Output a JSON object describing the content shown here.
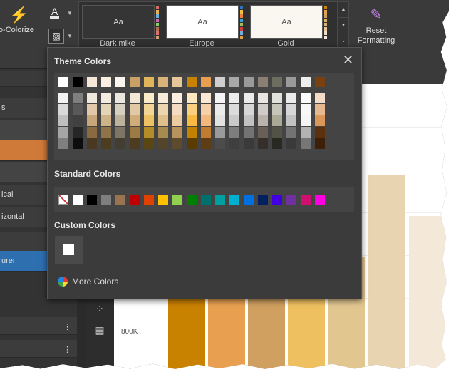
{
  "ribbon": {
    "auto_colorize_label": "o-Colorize",
    "font_color_glyph": "A",
    "fill_glyph": "▨",
    "reset_formatting_label": "Reset\nFormatting",
    "themes": [
      {
        "name": "Dark mike",
        "sample": "Aa",
        "bg": "#353535",
        "fg": "#d8d8d8"
      },
      {
        "name": "Europe",
        "sample": "Aa",
        "bg": "#ffffff",
        "fg": "#555555"
      },
      {
        "name": "Gold",
        "sample": "Aa",
        "bg": "#faf6f0",
        "fg": "#555555"
      }
    ]
  },
  "left_pane": {
    "items": [
      "s",
      "",
      "",
      "ical",
      "izontal",
      "",
      "urer",
      "",
      ""
    ]
  },
  "chart": {
    "y_tick_label": "800K"
  },
  "popup": {
    "theme_title": "Theme Colors",
    "standard_title": "Standard Colors",
    "custom_title": "Custom Colors",
    "more_colors_label": "More Colors",
    "theme_top_row": [
      "#ffffff",
      "#000000",
      "#f5e8d8",
      "#f8efe2",
      "#f7f5ee",
      "#c9a065",
      "#e1b55a",
      "#d8b37a",
      "#e8c79a",
      "#c98100",
      "#e8a050",
      "#cfcfcf",
      "#a8a8a8",
      "#9a9a9a",
      "#8a7f73",
      "#6e6e60",
      "#9a9a9a",
      "#eeeeee",
      "#7a4010"
    ],
    "theme_columns": [
      [
        "#f2f2f2",
        "#d9d9d9",
        "#bfbfbf",
        "#a6a6a6",
        "#7f7f7f"
      ],
      [
        "#7f7f7f",
        "#595959",
        "#404040",
        "#262626",
        "#0d0d0d"
      ],
      [
        "#f1e8dd",
        "#e0c8a8",
        "#c9a67a",
        "#8a6a40",
        "#4a3820"
      ],
      [
        "#f4ece0",
        "#e4d4b8",
        "#cdb488",
        "#8e7448",
        "#4c3c20"
      ],
      [
        "#eae7df",
        "#d6d0c0",
        "#bbb39c",
        "#7e7664",
        "#423e32"
      ],
      [
        "#f2e6d4",
        "#e1c9a5",
        "#cfac78",
        "#9c7a44",
        "#4e3c20"
      ],
      [
        "#faecc9",
        "#f3d696",
        "#ecc263",
        "#b58d28",
        "#5a4612"
      ],
      [
        "#f7ecd8",
        "#ebd6b0",
        "#dfc08a",
        "#a68a50",
        "#54452a"
      ],
      [
        "#faefe0",
        "#f3dcbf",
        "#edcba0",
        "#b8935c",
        "#5e4a2c"
      ],
      [
        "#fde8c0",
        "#fbd080",
        "#f9b840",
        "#c28200",
        "#5a3c00"
      ],
      [
        "#fbe8d4",
        "#f6d0a8",
        "#f2b97e",
        "#c07c30",
        "#5e3c14"
      ],
      [
        "#f5f5f5",
        "#ebebeb",
        "#e2e2e2",
        "#9a9a9a",
        "#4c4c4c"
      ],
      [
        "#ededed",
        "#dcdcdc",
        "#cacaca",
        "#7e7e7e",
        "#3f3f3f"
      ],
      [
        "#ebebeb",
        "#d7d7d7",
        "#c2c2c2",
        "#737373",
        "#3a3a3a"
      ],
      [
        "#e8e5e2",
        "#d1ccc7",
        "#bab3ab",
        "#685f56",
        "#342f2b"
      ],
      [
        "#e2e2dc",
        "#c5c5b9",
        "#a9a996",
        "#525246",
        "#292923"
      ],
      [
        "#ebebeb",
        "#d7d7d7",
        "#c2c2c2",
        "#737373",
        "#3a3a3a"
      ],
      [
        "#fcfcfc",
        "#f8f8f8",
        "#f5f5f5",
        "#b3b3b3",
        "#767676"
      ],
      [
        "#f3dcc8",
        "#e7b991",
        "#db965a",
        "#5c300c",
        "#3e2008"
      ]
    ],
    "standard_colors": [
      "none",
      "#ffffff",
      "#000000",
      "#7f7f7f",
      "#9a7450",
      "#c00000",
      "#e04000",
      "#ffc000",
      "#92d050",
      "#008000",
      "#00706a",
      "#00a0a0",
      "#00b0d0",
      "#0070e0",
      "#002060",
      "#4000e0",
      "#7030a0",
      "#d01070",
      "#ff00e0"
    ]
  }
}
